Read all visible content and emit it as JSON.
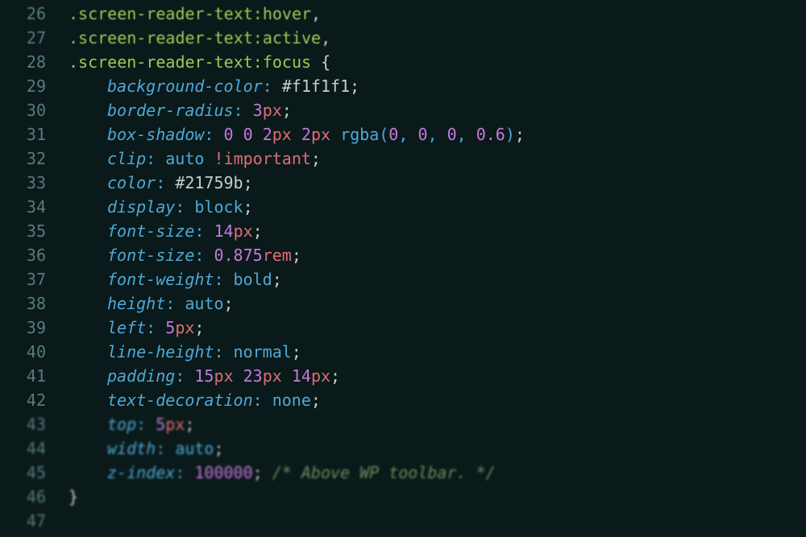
{
  "lines": [
    {
      "num": "26",
      "type": "selector",
      "sel": ".screen-reader-text",
      "pseudo": ":hover",
      "comma": ","
    },
    {
      "num": "27",
      "type": "selector",
      "sel": ".screen-reader-text",
      "pseudo": ":active",
      "comma": ","
    },
    {
      "num": "28",
      "type": "selector",
      "sel": ".screen-reader-text",
      "pseudo": ":focus",
      "brace": " {"
    },
    {
      "num": "29",
      "type": "decl",
      "prop": "background-color",
      "segs": [
        {
          "t": "color",
          "v": "#f1f1f1"
        }
      ]
    },
    {
      "num": "30",
      "type": "decl",
      "prop": "border-radius",
      "segs": [
        {
          "t": "num",
          "v": "3"
        },
        {
          "t": "unit",
          "v": "px"
        }
      ]
    },
    {
      "num": "31",
      "type": "decl",
      "prop": "box-shadow",
      "segs": [
        {
          "t": "num",
          "v": "0"
        },
        {
          "t": "sp"
        },
        {
          "t": "num",
          "v": "0"
        },
        {
          "t": "sp"
        },
        {
          "t": "num",
          "v": "2"
        },
        {
          "t": "unit",
          "v": "px"
        },
        {
          "t": "sp"
        },
        {
          "t": "num",
          "v": "2"
        },
        {
          "t": "unit",
          "v": "px"
        },
        {
          "t": "sp"
        },
        {
          "t": "func",
          "v": "rgba"
        },
        {
          "t": "paren",
          "v": "("
        },
        {
          "t": "num",
          "v": "0"
        },
        {
          "t": "comma",
          "v": ", "
        },
        {
          "t": "num",
          "v": "0"
        },
        {
          "t": "comma",
          "v": ", "
        },
        {
          "t": "num",
          "v": "0"
        },
        {
          "t": "comma",
          "v": ", "
        },
        {
          "t": "num",
          "v": "0.6"
        },
        {
          "t": "paren",
          "v": ")"
        }
      ]
    },
    {
      "num": "32",
      "type": "decl",
      "prop": "clip",
      "segs": [
        {
          "t": "kw",
          "v": "auto"
        },
        {
          "t": "sp"
        },
        {
          "t": "important",
          "v": "!important"
        }
      ]
    },
    {
      "num": "33",
      "type": "decl",
      "prop": "color",
      "segs": [
        {
          "t": "color",
          "v": "#21759b"
        }
      ]
    },
    {
      "num": "34",
      "type": "decl",
      "prop": "display",
      "segs": [
        {
          "t": "kw",
          "v": "block"
        }
      ]
    },
    {
      "num": "35",
      "type": "decl",
      "prop": "font-size",
      "segs": [
        {
          "t": "num",
          "v": "14"
        },
        {
          "t": "unit",
          "v": "px"
        }
      ]
    },
    {
      "num": "36",
      "type": "decl",
      "prop": "font-size",
      "segs": [
        {
          "t": "num",
          "v": "0.875"
        },
        {
          "t": "unit",
          "v": "rem"
        }
      ]
    },
    {
      "num": "37",
      "type": "decl",
      "prop": "font-weight",
      "segs": [
        {
          "t": "kw",
          "v": "bold"
        }
      ]
    },
    {
      "num": "38",
      "type": "decl",
      "prop": "height",
      "segs": [
        {
          "t": "kw",
          "v": "auto"
        }
      ]
    },
    {
      "num": "39",
      "type": "decl",
      "prop": "left",
      "segs": [
        {
          "t": "num",
          "v": "5"
        },
        {
          "t": "unit",
          "v": "px"
        }
      ]
    },
    {
      "num": "40",
      "type": "decl",
      "prop": "line-height",
      "segs": [
        {
          "t": "kw",
          "v": "normal"
        }
      ]
    },
    {
      "num": "41",
      "type": "decl",
      "prop": "padding",
      "segs": [
        {
          "t": "num",
          "v": "15"
        },
        {
          "t": "unit",
          "v": "px"
        },
        {
          "t": "sp"
        },
        {
          "t": "num",
          "v": "23"
        },
        {
          "t": "unit",
          "v": "px"
        },
        {
          "t": "sp"
        },
        {
          "t": "num",
          "v": "14"
        },
        {
          "t": "unit",
          "v": "px"
        }
      ]
    },
    {
      "num": "42",
      "type": "decl",
      "prop": "text-decoration",
      "segs": [
        {
          "t": "kw",
          "v": "none"
        }
      ]
    },
    {
      "num": "43",
      "type": "decl",
      "prop": "top",
      "segs": [
        {
          "t": "num",
          "v": "5"
        },
        {
          "t": "unit",
          "v": "px"
        }
      ]
    },
    {
      "num": "44",
      "type": "decl",
      "prop": "width",
      "segs": [
        {
          "t": "kw",
          "v": "auto"
        }
      ]
    },
    {
      "num": "45",
      "type": "decl",
      "prop": "z-index",
      "segs": [
        {
          "t": "num",
          "v": "100000"
        }
      ],
      "comment": "/* Above WP toolbar. */"
    },
    {
      "num": "46",
      "type": "close"
    },
    {
      "num": "47",
      "type": "empty"
    }
  ]
}
